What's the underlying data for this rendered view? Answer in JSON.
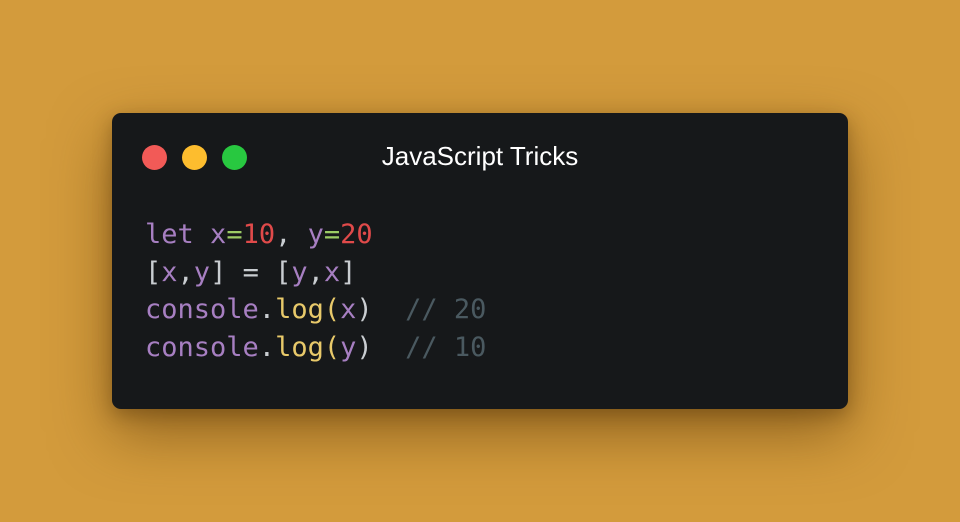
{
  "window": {
    "title": "JavaScript Tricks",
    "controls": [
      "close-button",
      "minimize-button",
      "maximize-button"
    ]
  },
  "colors": {
    "background": "#d39b3c",
    "window": "#16181a",
    "close": "#f25a57",
    "minimize": "#fdbd2e",
    "maximize": "#28c840",
    "keyword": "#a77fc2",
    "number": "#e04a4a",
    "operator": "#9ccc65",
    "function": "#e8c96a",
    "comment": "#4a5960",
    "text": "#c9cdd1"
  },
  "code": {
    "lines": [
      [
        {
          "t": "let",
          "c": "kw"
        },
        {
          "t": " ",
          "c": "punc"
        },
        {
          "t": "x",
          "c": "var"
        },
        {
          "t": "=",
          "c": "op"
        },
        {
          "t": "10",
          "c": "num"
        },
        {
          "t": ", ",
          "c": "punc"
        },
        {
          "t": "y",
          "c": "var"
        },
        {
          "t": "=",
          "c": "op"
        },
        {
          "t": "20",
          "c": "num"
        }
      ],
      [
        {
          "t": "[",
          "c": "punc"
        },
        {
          "t": "x",
          "c": "var"
        },
        {
          "t": ",",
          "c": "punc"
        },
        {
          "t": "y",
          "c": "var"
        },
        {
          "t": "] = [",
          "c": "punc"
        },
        {
          "t": "y",
          "c": "var"
        },
        {
          "t": ",",
          "c": "punc"
        },
        {
          "t": "x",
          "c": "var"
        },
        {
          "t": "]",
          "c": "punc"
        }
      ],
      [
        {
          "t": "console",
          "c": "var"
        },
        {
          "t": ".",
          "c": "punc"
        },
        {
          "t": "log",
          "c": "fn"
        },
        {
          "t": "(",
          "c": "fn"
        },
        {
          "t": "x",
          "c": "var"
        },
        {
          "t": ")",
          "c": "punc"
        },
        {
          "t": "  ",
          "c": "punc"
        },
        {
          "t": "// 20",
          "c": "cm"
        }
      ],
      [
        {
          "t": "console",
          "c": "var"
        },
        {
          "t": ".",
          "c": "punc"
        },
        {
          "t": "log",
          "c": "fn"
        },
        {
          "t": "(",
          "c": "fn"
        },
        {
          "t": "y",
          "c": "var"
        },
        {
          "t": ")",
          "c": "punc"
        },
        {
          "t": "  ",
          "c": "punc"
        },
        {
          "t": "// 10",
          "c": "cm"
        }
      ]
    ]
  }
}
